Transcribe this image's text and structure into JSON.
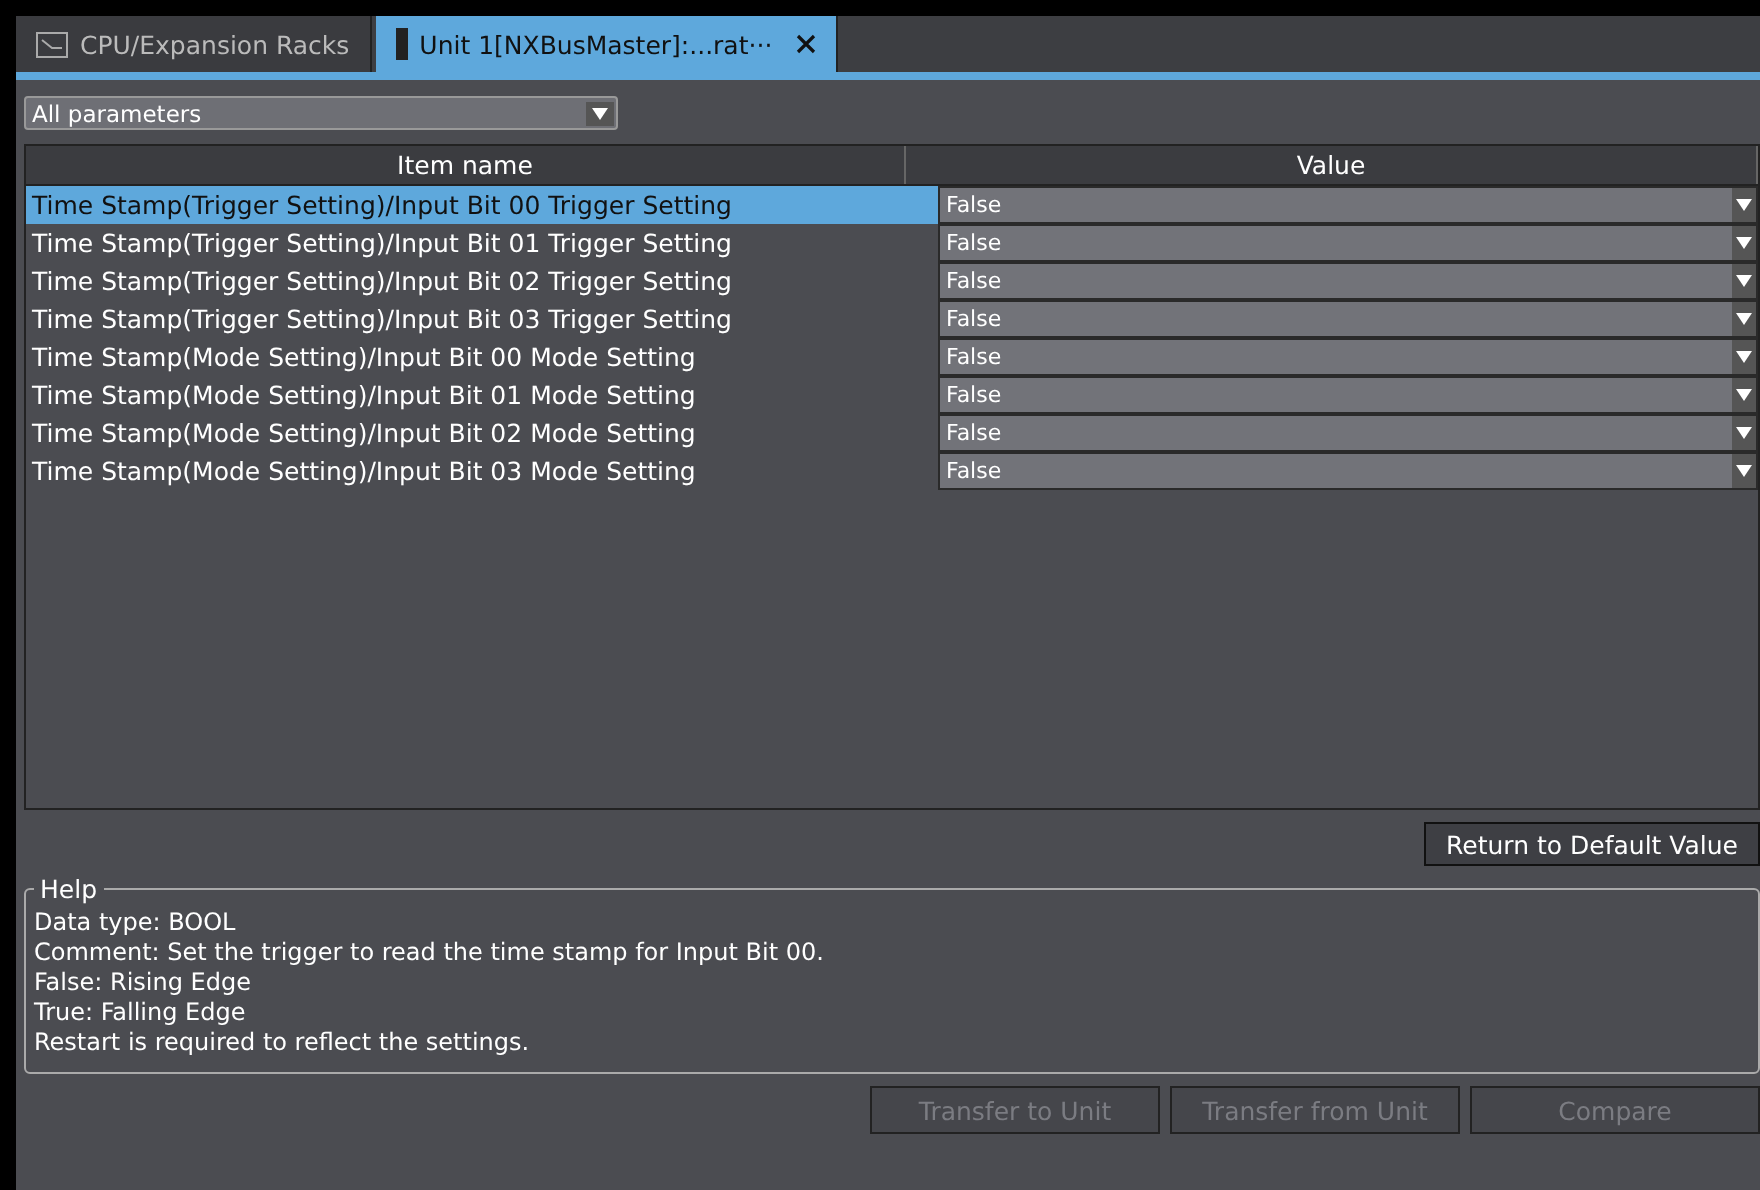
{
  "tabs": [
    {
      "label": "CPU/Expansion Racks",
      "selected": false,
      "closable": false
    },
    {
      "label": "Unit 1[NXBusMaster]:...rat···",
      "selected": true,
      "closable": true
    }
  ],
  "filter": {
    "value": "All parameters"
  },
  "table": {
    "columns": [
      "Item name",
      "Value"
    ],
    "rows": [
      {
        "name": "Time Stamp(Trigger Setting)/Input Bit 00 Trigger Setting",
        "value": "False",
        "selected": true
      },
      {
        "name": "Time Stamp(Trigger Setting)/Input Bit 01 Trigger Setting",
        "value": "False",
        "selected": false
      },
      {
        "name": "Time Stamp(Trigger Setting)/Input Bit 02 Trigger Setting",
        "value": "False",
        "selected": false
      },
      {
        "name": "Time Stamp(Trigger Setting)/Input Bit 03 Trigger Setting",
        "value": "False",
        "selected": false
      },
      {
        "name": "Time Stamp(Mode Setting)/Input Bit 00 Mode Setting",
        "value": "False",
        "selected": false
      },
      {
        "name": "Time Stamp(Mode Setting)/Input Bit 01 Mode Setting",
        "value": "False",
        "selected": false
      },
      {
        "name": "Time Stamp(Mode Setting)/Input Bit 02 Mode Setting",
        "value": "False",
        "selected": false
      },
      {
        "name": "Time Stamp(Mode Setting)/Input Bit 03 Mode Setting",
        "value": "False",
        "selected": false
      }
    ]
  },
  "default_button": {
    "label": "Return to Default Value",
    "disabled": false
  },
  "help": {
    "title": "Help",
    "lines": [
      "Data type: BOOL",
      "Comment: Set the trigger to read the time stamp for Input Bit 00.",
      "False: Rising Edge",
      "True:  Falling Edge",
      "Restart is required to reflect the settings."
    ]
  },
  "actions": [
    {
      "label": "Transfer to Unit",
      "disabled": true
    },
    {
      "label": "Transfer from Unit",
      "disabled": true
    },
    {
      "label": "Compare",
      "disabled": true
    }
  ]
}
